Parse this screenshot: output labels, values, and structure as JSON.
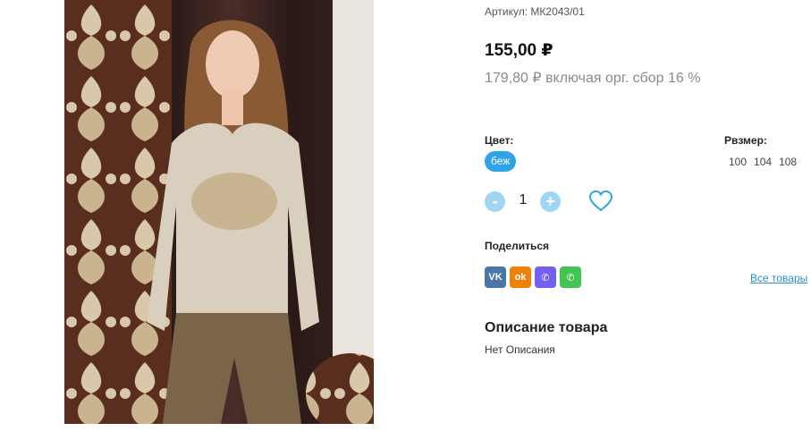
{
  "product": {
    "sku": "Артикул: МК2043/01",
    "price": "155,00 ₽",
    "price_with_fee": "179,80 ₽ включая орг. сбор 16 %"
  },
  "options": {
    "color_label": "Цвет:",
    "color_selected": "беж",
    "size_label": "Рвзмер:",
    "sizes": [
      "100",
      "104",
      "108"
    ]
  },
  "quantity": {
    "minus": "-",
    "value": "1",
    "plus": "+"
  },
  "share": {
    "label": "Поделиться",
    "networks": [
      {
        "icon": "vk-icon",
        "text": "VK",
        "color": "#4a76a8"
      },
      {
        "icon": "odnoklassniki-icon",
        "text": "ok",
        "color": "#ee8208"
      },
      {
        "icon": "viber-icon",
        "text": "✆",
        "color": "#7360f2"
      },
      {
        "icon": "whatsapp-icon",
        "text": "✆",
        "color": "#43c553"
      }
    ],
    "all_products": "Все товары"
  },
  "description": {
    "title": "Описание товара",
    "text": "Нет Описания"
  },
  "colors": {
    "accent": "#2ea3e8",
    "qty_button": "#9fd6f3",
    "heart": "#2ea3e8"
  }
}
